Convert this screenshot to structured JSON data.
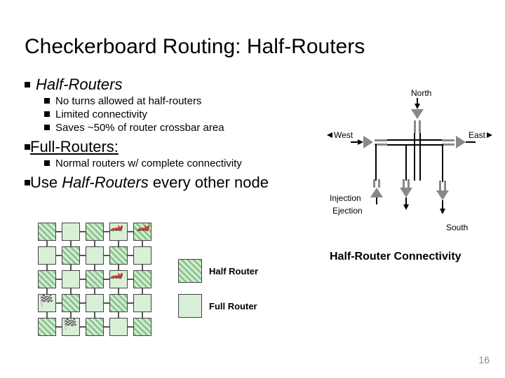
{
  "title": "Checkerboard Routing: Half-Routers",
  "bullets": {
    "hr_heading": "Half-Routers",
    "hr_items": [
      "No turns allowed at half-routers",
      "Limited connectivity",
      "Saves ~50% of router crossbar area"
    ],
    "fr_heading_prefix": "Full-Routers:",
    "fr_item": "Normal routers w/ complete connectivity",
    "use_line_prefix": "Use ",
    "use_line_mid": "Half-Routers",
    "use_line_suffix": " every other node"
  },
  "schematic": {
    "north": "North",
    "south": "South",
    "east": "East",
    "west": "West",
    "injection": "Injection",
    "ejection": "Ejection",
    "caption": "Half-Router Connectivity"
  },
  "grid": {
    "legend_half": "Half Router",
    "legend_full": "Full Router"
  },
  "page_number": "16"
}
